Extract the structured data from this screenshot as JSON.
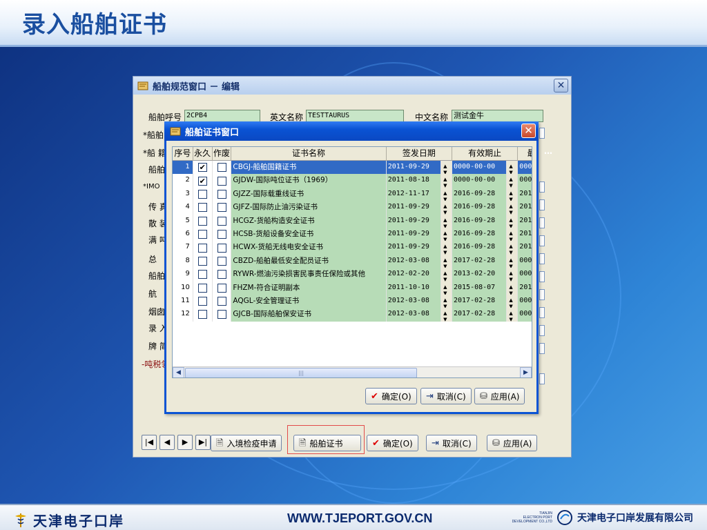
{
  "slide": {
    "title": "录入船舶证书",
    "footer_brand": "天津电子口岸",
    "footer_url": "WWW.TJEPORT.GOV.CN",
    "footer_small_lines": [
      "TIANJIN",
      "ELECTRON PORT",
      "DEVELOPMENT CO.,LTD"
    ],
    "footer_company": "天津电子口岸发展有限公司"
  },
  "main_window": {
    "title": "船舶规范窗口 － 编辑",
    "close_label": "✕",
    "fields": {
      "call_sign_label": "船舶呼号",
      "call_sign_value": "2CPB4",
      "english_name_label": "英文名称",
      "english_name_value": "TESTTAURUS",
      "chinese_name_label": "中文名称",
      "chinese_name_value": "测试金牛"
    },
    "side_labels": [
      "*船舶",
      "*船 籍",
      "船舶",
      "*IMO",
      "传 真",
      "散 装",
      "满 吨",
      "总",
      "船舶",
      "航",
      "烟囱",
      "录 入",
      "牌 简",
      "-吨税领"
    ],
    "ellipsis": "…",
    "nav": {
      "first": "|◀",
      "prev": "◀",
      "next": "▶",
      "last": "▶|"
    },
    "buttons": {
      "entry_quarantine": "入境检疫申请",
      "ship_certificate": "船舶证书",
      "confirm": "确定(O)",
      "cancel": "取消(C)",
      "apply": "应用(A)"
    }
  },
  "dialog": {
    "title": "船舶证书窗口",
    "close_label": "✕",
    "columns": [
      "序号",
      "永久",
      "作废",
      "证书名称",
      "签发日期",
      "有效期止",
      "最"
    ],
    "rows": [
      {
        "no": "1",
        "permanent": "✔",
        "void": "",
        "name": "CBGJ-船舶国籍证书",
        "issue": "2011-09-29",
        "expiry": "0000-00-00",
        "last": "000"
      },
      {
        "no": "2",
        "permanent": "✔",
        "void": "",
        "name": "GJDW-国际吨位证书（1969）",
        "issue": "2011-08-18",
        "expiry": "0000-00-00",
        "last": "000"
      },
      {
        "no": "3",
        "permanent": "",
        "void": "",
        "name": "GJZZ-国际载重线证书",
        "issue": "2012-11-17",
        "expiry": "2016-09-28",
        "last": "201"
      },
      {
        "no": "4",
        "permanent": "",
        "void": "",
        "name": "GJFZ-国际防止油污染证书",
        "issue": "2011-09-29",
        "expiry": "2016-09-28",
        "last": "201"
      },
      {
        "no": "5",
        "permanent": "",
        "void": "",
        "name": "HCGZ-货船构造安全证书",
        "issue": "2011-09-29",
        "expiry": "2016-09-28",
        "last": "201"
      },
      {
        "no": "6",
        "permanent": "",
        "void": "",
        "name": "HCSB-货船设备安全证书",
        "issue": "2011-09-29",
        "expiry": "2016-09-28",
        "last": "201"
      },
      {
        "no": "7",
        "permanent": "",
        "void": "",
        "name": "HCWX-货船无线电安全证书",
        "issue": "2011-09-29",
        "expiry": "2016-09-28",
        "last": "201"
      },
      {
        "no": "8",
        "permanent": "",
        "void": "",
        "name": "CBZD-船舶最低安全配员证书",
        "issue": "2012-03-08",
        "expiry": "2017-02-28",
        "last": "000"
      },
      {
        "no": "9",
        "permanent": "",
        "void": "",
        "name": "RYWR-燃油污染损害民事责任保险或其他",
        "issue": "2012-02-20",
        "expiry": "2013-02-20",
        "last": "000"
      },
      {
        "no": "10",
        "permanent": "",
        "void": "",
        "name": "FHZM-符合证明副本",
        "issue": "2011-10-10",
        "expiry": "2015-08-07",
        "last": "201"
      },
      {
        "no": "11",
        "permanent": "",
        "void": "",
        "name": "AQGL-安全管理证书",
        "issue": "2012-03-08",
        "expiry": "2017-02-28",
        "last": "000"
      },
      {
        "no": "12",
        "permanent": "",
        "void": "",
        "name": "GJCB-国际船舶保安证书",
        "issue": "2012-03-08",
        "expiry": "2017-02-28",
        "last": "000"
      }
    ],
    "scrollbar_grip": "|||",
    "buttons": {
      "confirm": "确定(O)",
      "cancel": "取消(C)",
      "apply": "应用(A)"
    }
  },
  "colors": {
    "accent": "#0a53d4",
    "field_green": "#b7dcb7",
    "selection": "#316ac5",
    "highlight": "#e24a4a"
  }
}
